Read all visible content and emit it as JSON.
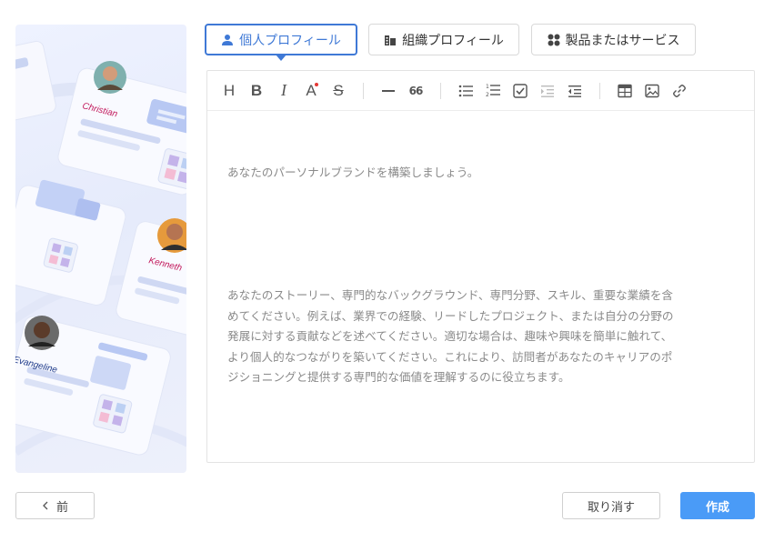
{
  "tabs": [
    {
      "label": "個人プロフィール",
      "icon": "person-icon",
      "active": true
    },
    {
      "label": "組織プロフィール",
      "icon": "building-icon",
      "active": false
    },
    {
      "label": "製品またはサービス",
      "icon": "grid-icon",
      "active": false
    }
  ],
  "illustration": {
    "names": [
      "Christian",
      "Kenneth",
      "Evangeline"
    ]
  },
  "toolbar": {
    "heading": "H",
    "bold": "B",
    "italic": "I",
    "color": "A",
    "strike": "S",
    "quote": "66"
  },
  "editor": {
    "line1": "あなたのパーソナルブランドを構築しましょう。",
    "paragraph": "あなたのストーリー、専門的なバックグラウンド、専門分野、スキル、重要な業績を含\nめてください。例えば、業界での経験、リードしたプロジェクト、または自分の分野の\n発展に対する貢献などを述べてください。適切な場合は、趣味や興味を簡単に触れて、\nより個人的なつながりを築いてください。これにより、訪問者があなたのキャリアのポ\nジショニングと提供する専門的な価値を理解するのに役立ちます。"
  },
  "buttons": {
    "back": "前",
    "cancel": "取り消す",
    "create": "作成"
  },
  "colors": {
    "accent": "#3f79d6",
    "primary_button": "#4a9bf7"
  }
}
